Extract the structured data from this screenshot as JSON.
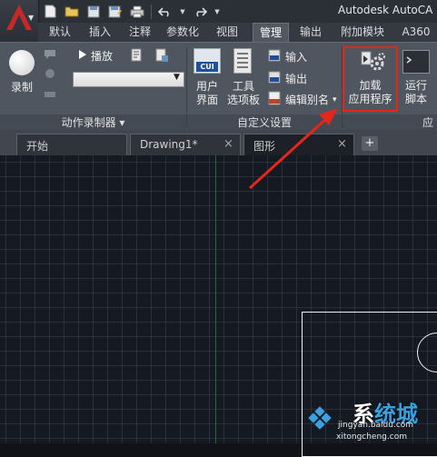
{
  "window": {
    "title": "Autodesk AutoCA"
  },
  "colors": {
    "highlight": "#e4271b",
    "brand_red": "#c8282a",
    "cui_blue": "#1e4f9c",
    "axis_green": "#2b6a2b"
  },
  "quick_access": {
    "icons": [
      "new-file-icon",
      "open-folder-icon",
      "save-icon",
      "save-as-icon",
      "print-icon",
      "undo-icon",
      "redo-icon"
    ]
  },
  "ribbon_tabs": [
    "默认",
    "插入",
    "注释",
    "参数化",
    "视图",
    "管理",
    "输出",
    "附加模块",
    "A360"
  ],
  "active_tab": "管理",
  "ribbon": {
    "record_label": "录制",
    "play_label": "播放",
    "action_recorder_title": "动作录制器",
    "action_recorder_arrow": "▾",
    "cui_icon_text": "CUI",
    "user_interface_label_1": "用户",
    "user_interface_label_2": "界面",
    "tool_palettes_label_1": "工具",
    "tool_palettes_label_2": "选项板",
    "import_label": "输入",
    "export_label": "输出",
    "edit_aliases_label": "编辑别名",
    "edit_aliases_arrow": "▾",
    "customization_title": "自定义设置",
    "load_app_label_1": "加载",
    "load_app_label_2": "应用程序",
    "run_script_label_1": "运行",
    "run_script_label_2": "脚本",
    "applications_title_partial": "应"
  },
  "document_tabs": [
    {
      "label": "开始"
    },
    {
      "label": "Drawing1*"
    },
    {
      "label": "图形"
    }
  ],
  "new_tab_label": "+",
  "close_glyph": "×",
  "watermark": {
    "main_prefix": "系",
    "main_accent": "统城",
    "line1": "jingyan.baidu.com",
    "line2": "xitongcheng.com"
  }
}
